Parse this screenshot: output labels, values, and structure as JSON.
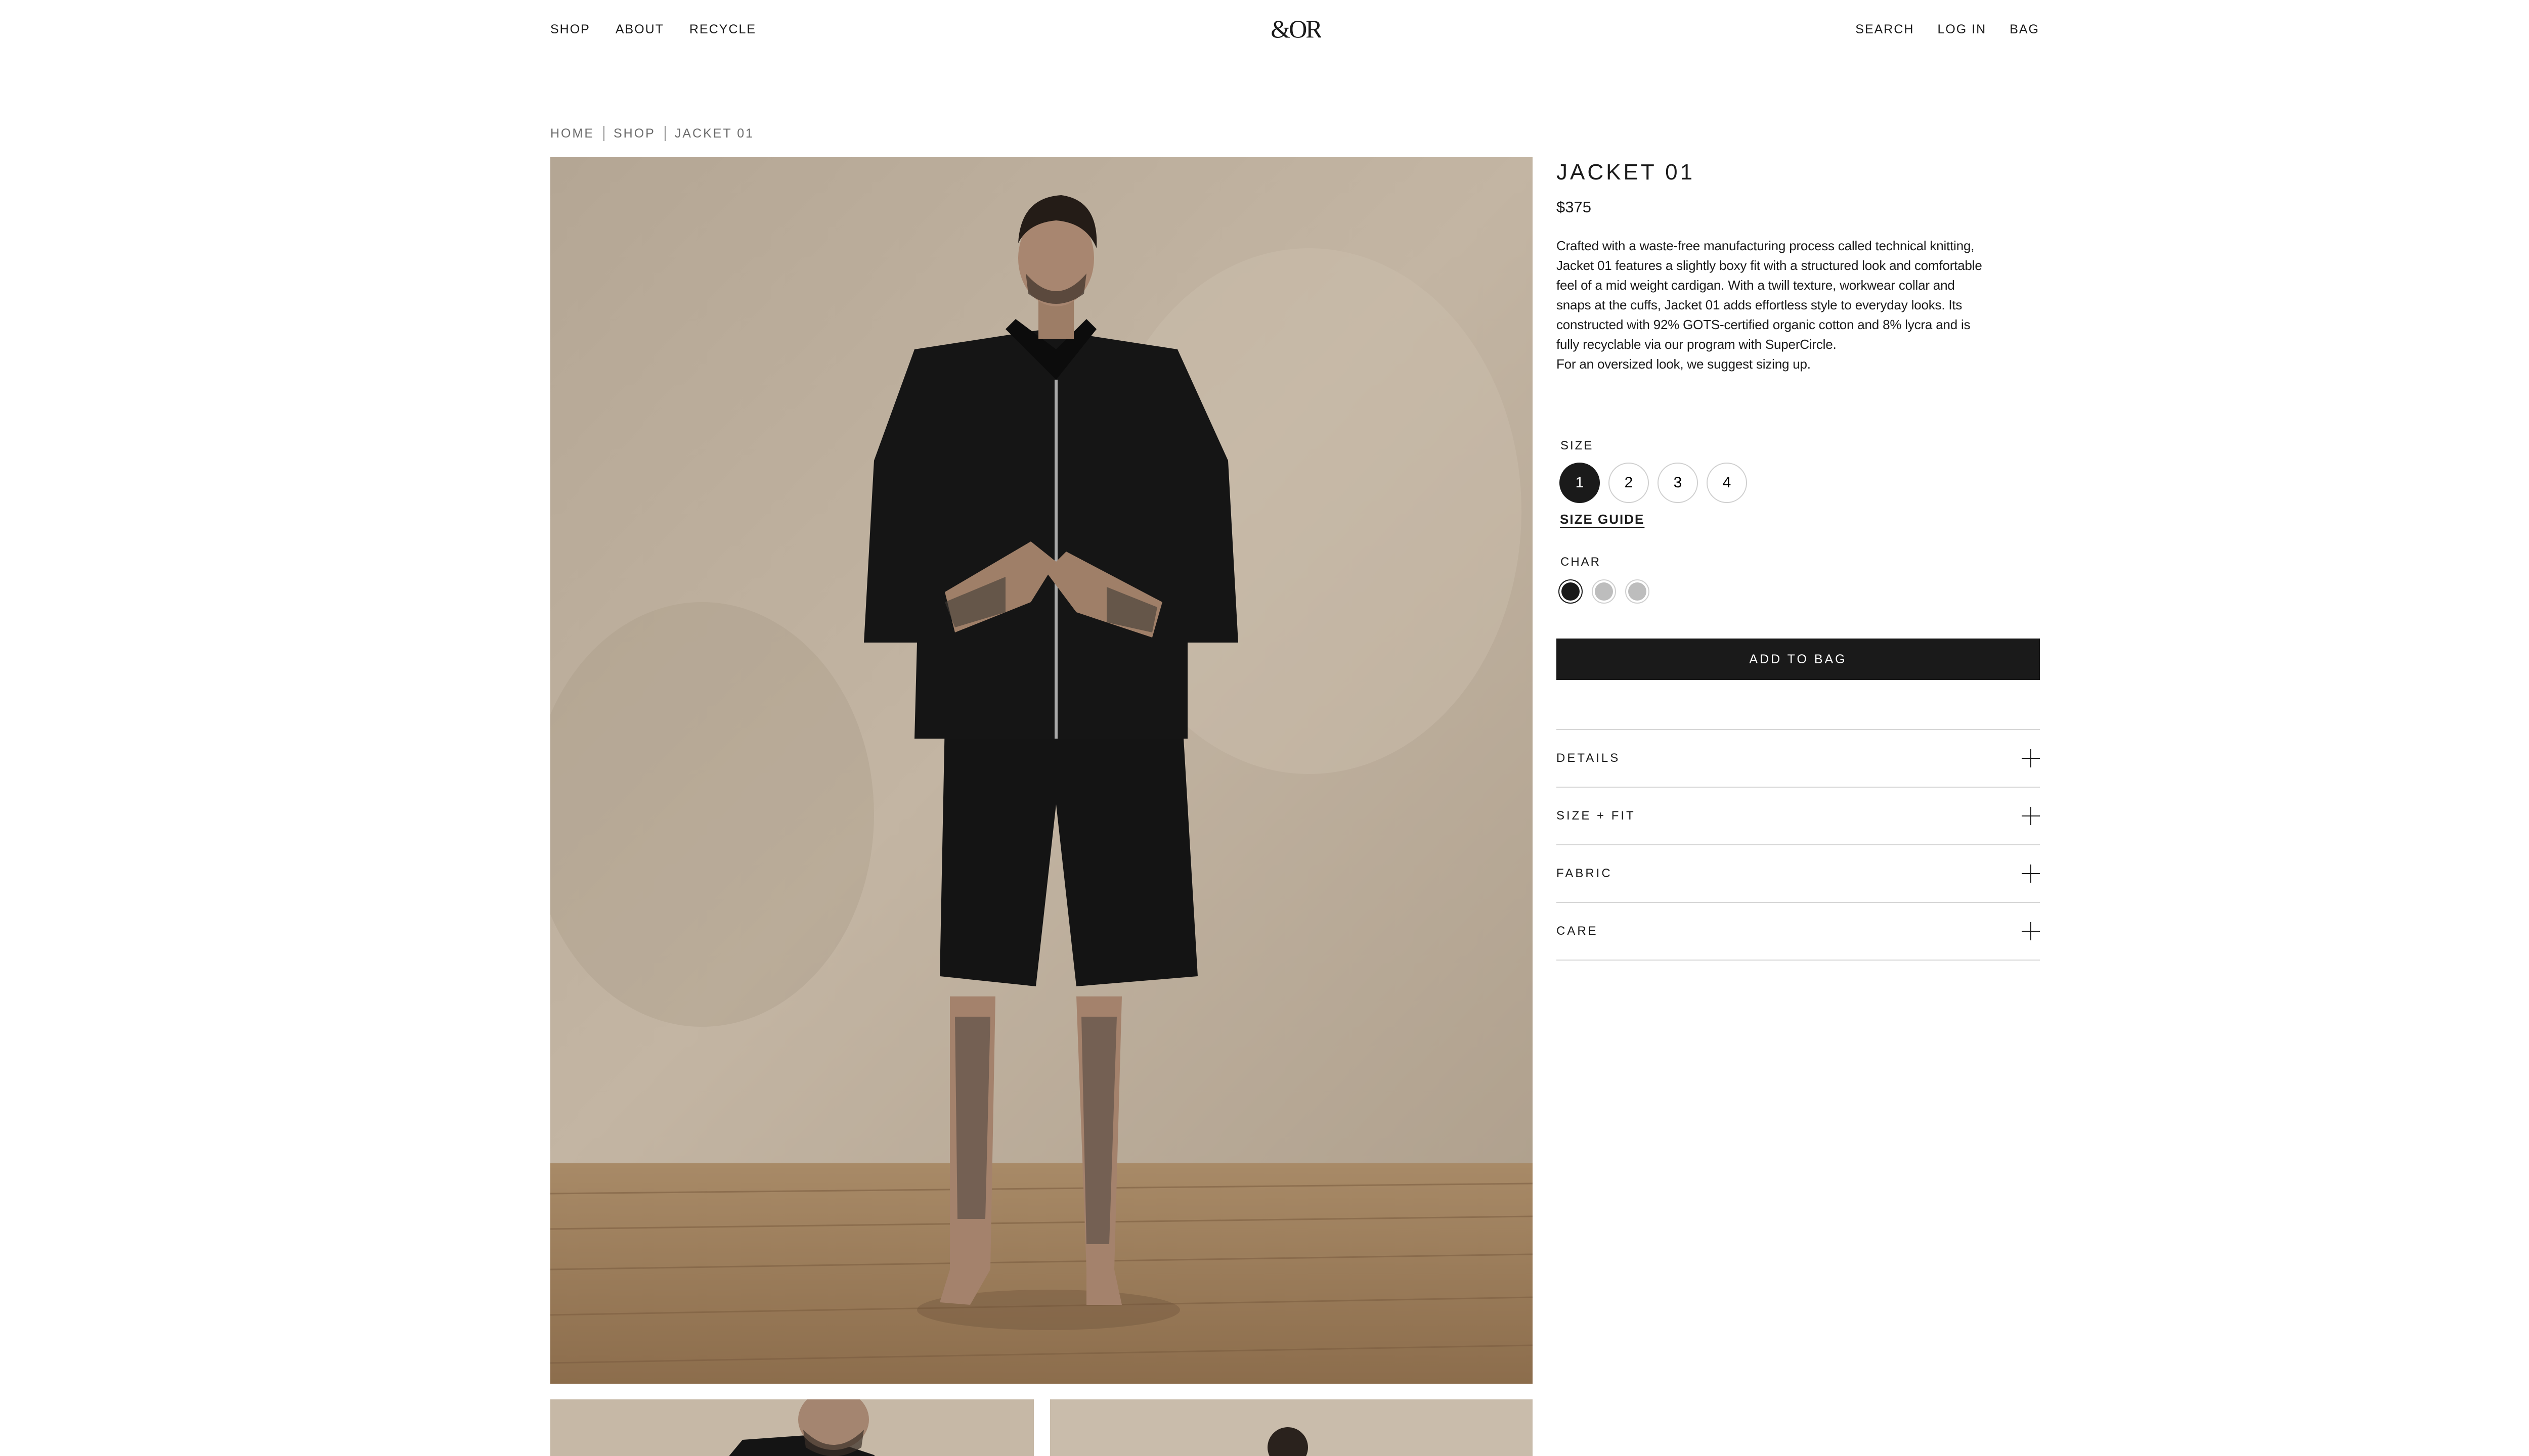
{
  "nav": {
    "left": [
      "SHOP",
      "ABOUT",
      "RECYCLE"
    ],
    "right": [
      "SEARCH",
      "LOG IN",
      "BAG"
    ]
  },
  "logo": "&OR",
  "breadcrumb": [
    "HOME",
    "SHOP",
    "JACKET 01"
  ],
  "product": {
    "title": "JACKET 01",
    "price": "$375",
    "description": [
      "Crafted with a waste-free manufacturing process called technical knitting,",
      "Jacket 01 features a slightly boxy fit with a structured look and comfortable",
      "feel of a mid weight cardigan. With a twill texture, workwear collar and",
      "snaps at the cuffs, Jacket 01 adds effortless style to everyday looks. Its",
      "constructed with 92% GOTS-certified organic cotton and 8% lycra and is",
      "fully recyclable via our program with SuperCircle.",
      "For an oversized look, we suggest sizing up."
    ],
    "size_label": "SIZE",
    "sizes": [
      "1",
      "2",
      "3",
      "4"
    ],
    "selected_size": "1",
    "size_guide": "SIZE GUIDE",
    "color_label": "CHAR",
    "colors": [
      "#1a1a1a",
      "#bdbdbd",
      "#bdbdbd"
    ],
    "add_to_bag": "ADD TO BAG",
    "accordion": [
      "DETAILS",
      "SIZE + FIT",
      "FABRIC",
      "CARE"
    ]
  }
}
